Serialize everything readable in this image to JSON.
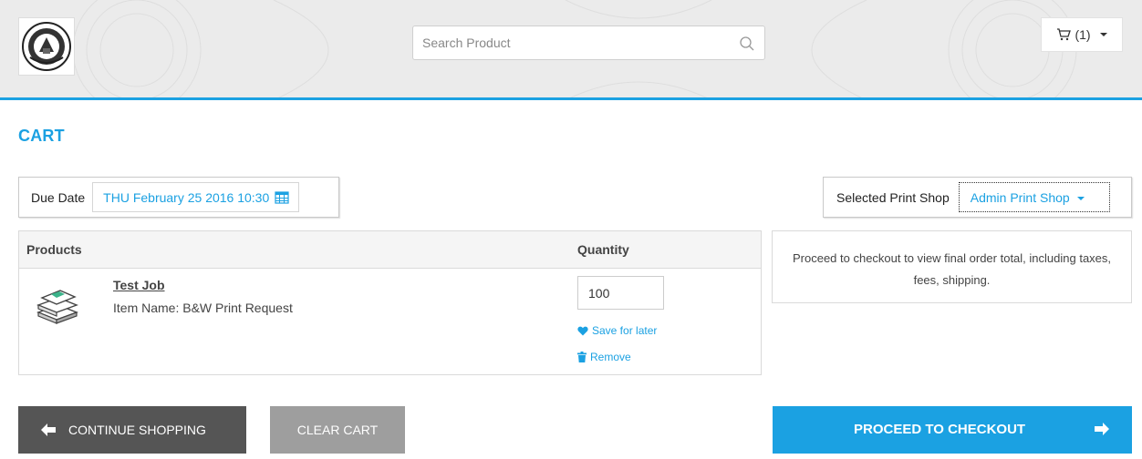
{
  "header": {
    "search_placeholder": "Search Product",
    "cart_count": "(1)",
    "icons": {
      "logo": "seal-logo",
      "search": "search-icon",
      "cart": "cart-icon",
      "dropdown": "chevron-down-icon"
    }
  },
  "page": {
    "title": "CART"
  },
  "due_date": {
    "label": "Due Date",
    "value": "THU February 25 2016 10:30",
    "icon": "calendar-icon"
  },
  "print_shop": {
    "label": "Selected Print Shop",
    "value": "Admin Print Shop"
  },
  "products": {
    "headers": {
      "products": "Products",
      "quantity": "Quantity"
    },
    "items": [
      {
        "name": "Test Job",
        "item_name": "Item Name: B&W Print Request",
        "quantity": "100",
        "save_label": "Save for later",
        "remove_label": "Remove"
      }
    ]
  },
  "summary": {
    "text": "Proceed to checkout to view final order total, including taxes, fees, shipping."
  },
  "actions": {
    "continue_label": "CONTINUE SHOPPING",
    "clear_label": "CLEAR CART",
    "checkout_label": "PROCEED TO CHECKOUT"
  },
  "colors": {
    "accent": "#1ba1e2",
    "dark_button": "#555555",
    "grey_button": "#9e9e9e",
    "header_bg": "#ebebeb"
  }
}
